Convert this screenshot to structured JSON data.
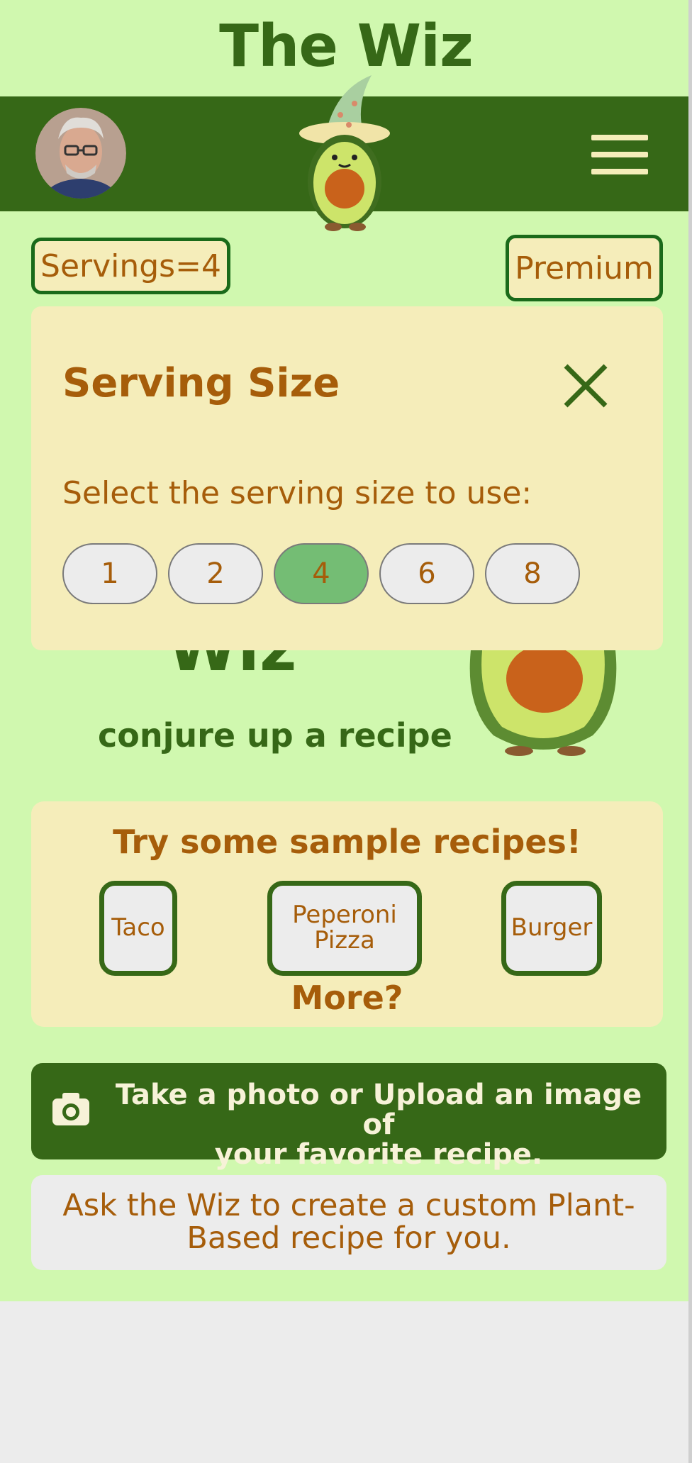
{
  "app": {
    "title": "The Wiz"
  },
  "header": {
    "menu_icon": "hamburger-menu-icon",
    "avatar": "user-avatar",
    "mascot": "avocado-wizard-mascot"
  },
  "top_controls": {
    "servings_label": "Servings=4",
    "premium_label": "Premium"
  },
  "modal": {
    "title": "Serving Size",
    "close_icon": "close-icon",
    "prompt": "Select the serving size to use:",
    "options": [
      "1",
      "2",
      "4",
      "6",
      "8"
    ],
    "selected": "4"
  },
  "hero": {
    "brand_fragment": "Wiz",
    "tagline": "conjure up a recipe"
  },
  "samples": {
    "title": "Try some sample recipes!",
    "recipes": [
      "Taco",
      "Peperoni Pizza",
      "Burger"
    ],
    "more": "More?"
  },
  "actions": {
    "photo_icon": "camera-icon",
    "photo_line1": "Take a photo or Upload an image of",
    "photo_line2": "your favorite recipe.",
    "ask_line1": "Ask the Wiz to create a custom Plant-",
    "ask_line2": "Based recipe for you."
  },
  "colors": {
    "bg": "#d0f8af",
    "header": "#366817",
    "cream": "#f5edba",
    "brown": "#a65d0a",
    "selected": "#74bd74"
  }
}
